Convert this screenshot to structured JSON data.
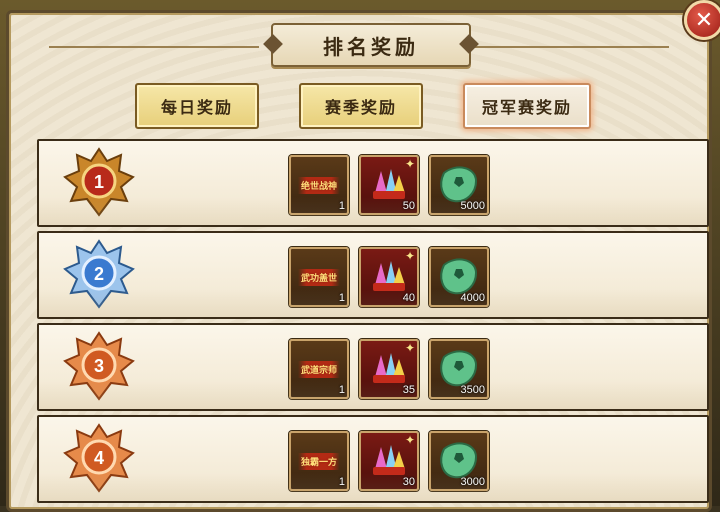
{
  "dialog": {
    "title": "排名奖励",
    "close_label": "✕"
  },
  "tabs": [
    {
      "label": "每日奖励",
      "active": false
    },
    {
      "label": "赛季奖励",
      "active": false
    },
    {
      "label": "冠军赛奖励",
      "active": true
    }
  ],
  "rows": [
    {
      "rank": "1",
      "medal_color": "#d08a2c",
      "title_item": "绝世战神",
      "title_count": "1",
      "gem_count": "50",
      "jade_count": "5000"
    },
    {
      "rank": "2",
      "medal_color": "#4c8ad8",
      "title_item": "武功盖世",
      "title_count": "1",
      "gem_count": "40",
      "jade_count": "4000"
    },
    {
      "rank": "3",
      "medal_color": "#e0763a",
      "title_item": "武道宗师",
      "title_count": "1",
      "gem_count": "35",
      "jade_count": "3500"
    },
    {
      "rank": "4",
      "medal_color": "#e0763a",
      "title_item": "独霸一方",
      "title_count": "1",
      "gem_count": "30",
      "jade_count": "3000"
    }
  ],
  "icons": {
    "title_item": "title-scroll-icon",
    "gem_item": "crystal-gem-icon",
    "jade_item": "jade-stone-icon"
  }
}
